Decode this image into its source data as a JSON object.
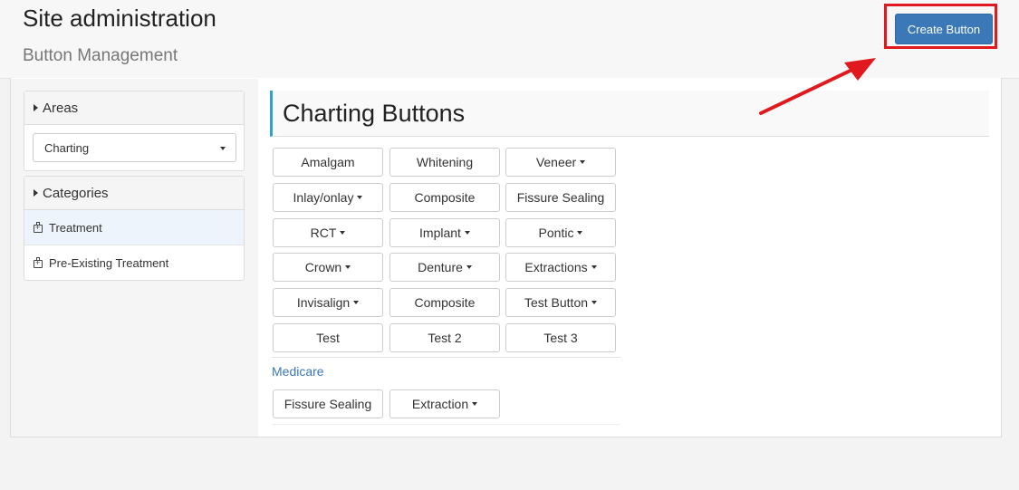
{
  "header": {
    "title": "Site administration",
    "subtitle": "Button Management",
    "create_button": "Create Button"
  },
  "sidebar": {
    "areas": {
      "title": "Areas",
      "selected": "Charting"
    },
    "categories": {
      "title": "Categories",
      "items": [
        {
          "label": "Treatment",
          "active": true
        },
        {
          "label": "Pre-Existing Treatment",
          "active": false
        }
      ]
    }
  },
  "main": {
    "title": "Charting Buttons",
    "buttons": [
      {
        "label": "Amalgam",
        "dropdown": false
      },
      {
        "label": "Whitening",
        "dropdown": false
      },
      {
        "label": "Veneer",
        "dropdown": true
      },
      {
        "label": "Inlay/onlay",
        "dropdown": true
      },
      {
        "label": "Composite",
        "dropdown": false
      },
      {
        "label": "Fissure Sealing",
        "dropdown": false
      },
      {
        "label": "RCT",
        "dropdown": true
      },
      {
        "label": "Implant",
        "dropdown": true
      },
      {
        "label": "Pontic",
        "dropdown": true
      },
      {
        "label": "Crown",
        "dropdown": true
      },
      {
        "label": "Denture",
        "dropdown": true
      },
      {
        "label": "Extractions",
        "dropdown": true
      },
      {
        "label": "Invisalign",
        "dropdown": true
      },
      {
        "label": "Composite",
        "dropdown": false
      },
      {
        "label": "Test Button",
        "dropdown": true
      },
      {
        "label": "Test",
        "dropdown": false
      },
      {
        "label": "Test 2",
        "dropdown": false
      },
      {
        "label": "Test 3",
        "dropdown": false
      }
    ],
    "medicare": {
      "title": "Medicare",
      "buttons": [
        {
          "label": "Fissure Sealing",
          "dropdown": false
        },
        {
          "label": "Extraction",
          "dropdown": true
        }
      ]
    }
  },
  "colors": {
    "primary": "#3a78b8",
    "highlight": "#e0191f",
    "title_accent": "#2fa3c6"
  }
}
